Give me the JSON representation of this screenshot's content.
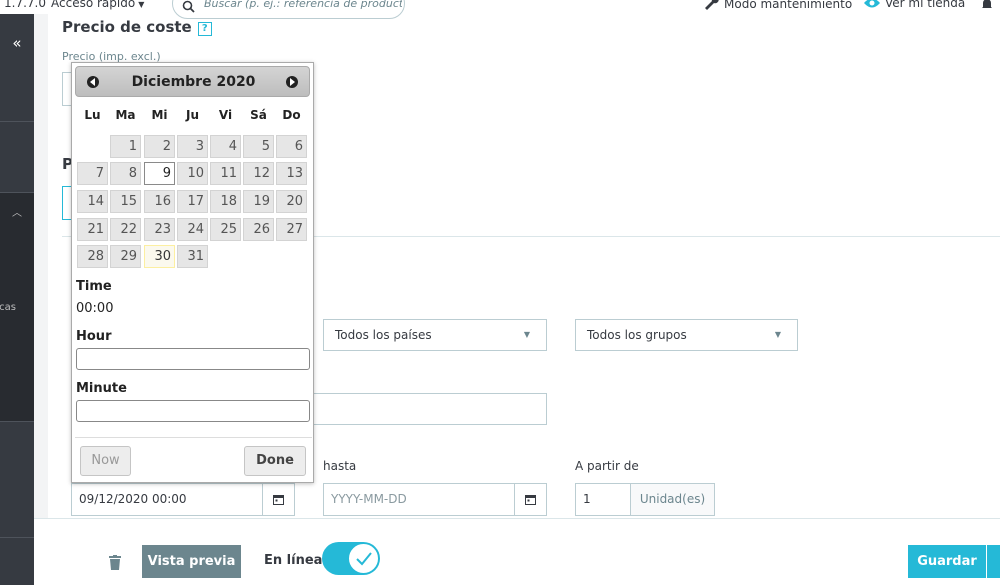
{
  "topbar": {
    "version": "1.7.7.0",
    "quick_access": "Acceso rápido",
    "search_placeholder": "Buscar (p. ej.: referencia de producto, no",
    "maintenance": "Modo mantenimiento",
    "view_store": "Ver mi tienda"
  },
  "sidebar": {
    "collapse": "«",
    "partial_label": "cas"
  },
  "cost": {
    "title": "Precio de coste",
    "help": "?",
    "price_label": "Precio (imp. excl.)"
  },
  "hidden_title_initial": "P",
  "filters": {
    "country": "Todos los países",
    "group": "Todos los grupos"
  },
  "dates": {
    "to_label": "hasta",
    "from_label": "A partir de",
    "from_value": "09/12/2020 00:00",
    "to_placeholder": "YYYY-MM-DD",
    "quantity": "1",
    "unit": "Unidad(es)"
  },
  "datepicker": {
    "month_year": "Diciembre 2020",
    "weekdays": [
      "Lu",
      "Ma",
      "Mi",
      "Ju",
      "Vi",
      "Sá",
      "Do"
    ],
    "selected_day": 9,
    "today": 30,
    "time_label": "Time",
    "time_value": "00:00",
    "hour_label": "Hour",
    "minute_label": "Minute",
    "now_label": "Now",
    "done_label": "Done"
  },
  "footer": {
    "preview": "Vista previa",
    "online": "En línea",
    "online_enabled": true,
    "save": "Guardar"
  },
  "colors": {
    "accent": "#25b9d7",
    "sidebar": "#363a41",
    "secondary_button": "#6c868e"
  }
}
